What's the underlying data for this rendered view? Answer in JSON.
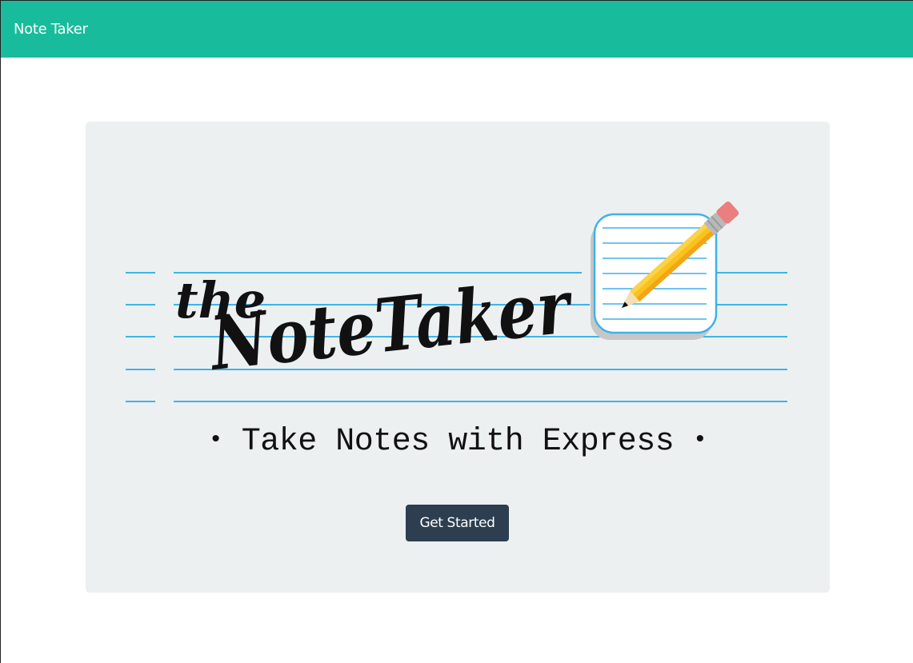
{
  "navbar": {
    "brand": "Note Taker"
  },
  "hero": {
    "logo": {
      "line1": "the",
      "line2": "NoteTaker",
      "icon": "notepad-pencil-icon"
    },
    "tagline": {
      "bullet": "•",
      "text": "Take Notes with Express"
    },
    "cta_label": "Get Started"
  },
  "colors": {
    "navbar": "#18bc9c",
    "hero_bg": "#ecf0f1",
    "button": "#2c3e50",
    "lines": "#3fb2e8"
  }
}
